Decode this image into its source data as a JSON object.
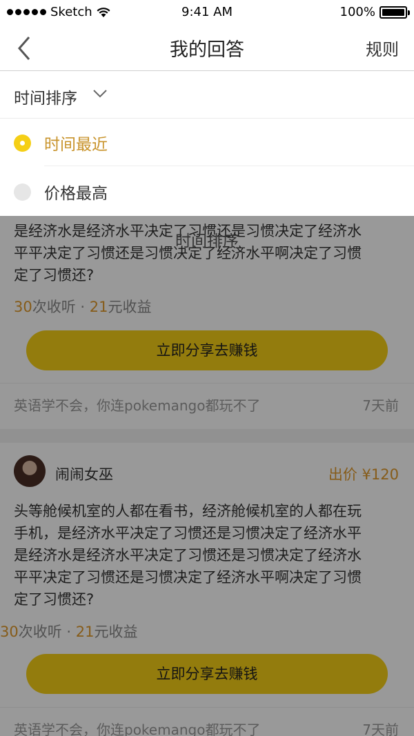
{
  "status_bar": {
    "carrier": "Sketch",
    "time": "9:41 AM",
    "battery": "100%"
  },
  "nav": {
    "title": "我的回答",
    "right_link": "规则"
  },
  "sort": {
    "header_label": "时间排序",
    "options": [
      {
        "label": "时间最近",
        "selected": true
      },
      {
        "label": "价格最高",
        "selected": false
      }
    ],
    "ghost_label": "时间排序"
  },
  "cards": [
    {
      "text_lines": [
        "是经济水是经济水平决定了习惯还是习惯决定了经济水",
        "平平决定了习惯还是习惯决定了经济水平啊决定了习惯",
        "定了习惯还?"
      ],
      "stats": {
        "listens_num": "30",
        "listens_unit": "次收听",
        "separator": " · ",
        "income_num": "21",
        "income_unit": "元收益"
      },
      "share_label": "立即分享去赚钱",
      "footer": {
        "title": "英语学不会，你连pokemango都玩不了",
        "ago": "7天前"
      }
    },
    {
      "user": {
        "name": "闹闹女巫"
      },
      "price": "出价 ¥120",
      "text_lines": [
        "头等舱候机室的人都在看书，经济舱候机室的人都在玩",
        "手机，是经济水平决定了习惯还是习惯决定了经济水平",
        "是经济水是经济水平决定了习惯还是习惯决定了经济水",
        "平平决定了习惯还是习惯决定了经济水平啊决定了习惯",
        "定了习惯还?"
      ],
      "stats": {
        "listens_num": "30",
        "listens_unit": "次收听",
        "separator": " · ",
        "income_num": "21",
        "income_unit": "元收益"
      },
      "share_label": "立即分享去赚钱",
      "footer": {
        "title": "英语学不会，你连pokemango都玩不了",
        "ago": "7天前"
      }
    }
  ]
}
